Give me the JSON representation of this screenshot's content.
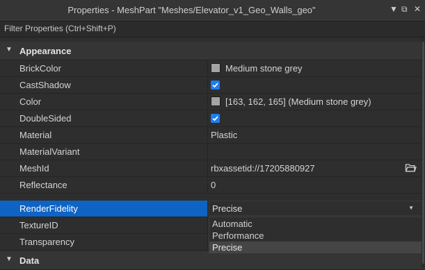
{
  "window": {
    "title": "Properties - MeshPart \"Meshes/Elevator_v1_Geo_Walls_geo\"",
    "buttons": [
      "chevron-down-icon",
      "restore-icon",
      "close-icon"
    ]
  },
  "filter": {
    "placeholder": "Filter Properties (Ctrl+Shift+P)"
  },
  "sections": [
    {
      "label": "Appearance",
      "expanded": true
    },
    {
      "label": "Data",
      "expanded": true
    }
  ],
  "properties": {
    "brickcolor": {
      "name": "BrickColor",
      "value": "Medium stone grey",
      "swatch": "#a3a2a5"
    },
    "castshadow": {
      "name": "CastShadow",
      "checked": true
    },
    "color": {
      "name": "Color",
      "value": "[163, 162, 165] (Medium stone grey)",
      "swatch": "#a3a2a5"
    },
    "doublesided": {
      "name": "DoubleSided",
      "checked": true
    },
    "material": {
      "name": "Material",
      "value": "Plastic"
    },
    "materialvariant": {
      "name": "MaterialVariant",
      "value": ""
    },
    "meshid": {
      "name": "MeshId",
      "value": "rbxassetid://17205880927"
    },
    "reflectance": {
      "name": "Reflectance",
      "value": "0"
    },
    "renderfidelity": {
      "name": "RenderFidelity",
      "value": "Precise"
    },
    "textureid": {
      "name": "TextureID",
      "value": ""
    },
    "transparency": {
      "name": "Transparency",
      "value": ""
    }
  },
  "dropdown": {
    "options": [
      "Automatic",
      "Performance",
      "Precise"
    ],
    "selected": "Precise"
  },
  "colors": {
    "accent": "#0e63c4",
    "checkbox": "#1e7ef0",
    "background": "#2e2e2e"
  }
}
